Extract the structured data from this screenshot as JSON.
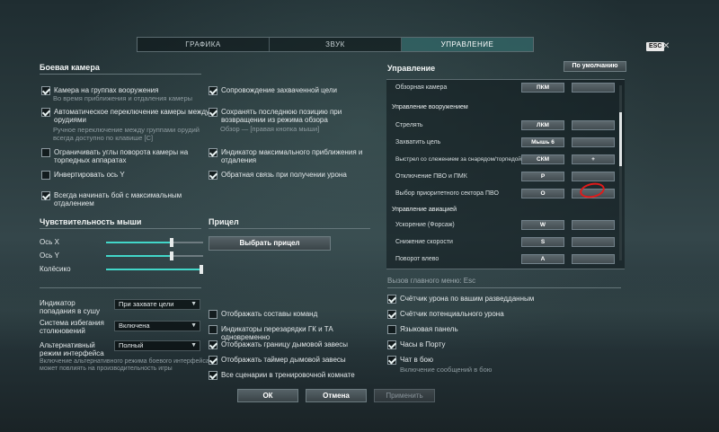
{
  "tabs": [
    "ГРАФИКА",
    "ЗВУК",
    "УПРАВЛЕНИЕ"
  ],
  "esc_label": "ESC",
  "close_glyph": "✕",
  "left": {
    "camera_title": "Боевая камера",
    "checks": [
      {
        "label": "Камера на группах вооружения",
        "hint": "Во время приближения и отдаления камеры",
        "on": true
      },
      {
        "label": "Автоматическое переключение камеры между орудиями",
        "hint": "Ручное переключение между группами орудий всегда доступно по клавише [C]",
        "on": true
      },
      {
        "label": "Ограничивать углы поворота камеры на торпедных аппаратах",
        "on": false
      },
      {
        "label": "Инвертировать ось Y",
        "on": false
      },
      {
        "label": "Всегда начинать бой с максимальным отдалением",
        "on": true
      }
    ],
    "mouse_title": "Чувствительность мыши",
    "sliders": [
      {
        "label": "Ось X",
        "value": 0.66
      },
      {
        "label": "Ось Y",
        "value": 0.66
      },
      {
        "label": "Колёсико",
        "value": 1.0
      }
    ],
    "fields": [
      {
        "label": "Индикатор попадания в сушу",
        "value": "При захвате цели"
      },
      {
        "label": "Система избегания столкновений",
        "value": "Включена"
      },
      {
        "label": "Альтернативный режим интерфейса",
        "value": "Полный"
      }
    ],
    "interface_hint": "Включение альтернативного режима боевого интерфейса может повлиять на производительность игры"
  },
  "middle": {
    "checks": [
      {
        "label": "Сопровождение захваченной цели",
        "on": true
      },
      {
        "label": "Сохранять последнюю позицию при возвращении из режима обзора",
        "hint": "Обзор — [правая кнопка мыши]",
        "on": true
      },
      {
        "label": "Индикатор максимального приближения и отдаления",
        "on": true
      },
      {
        "label": "Обратная связь при получении урона",
        "on": true
      }
    ],
    "sight_title": "Прицел",
    "sight_button": "Выбрать прицел",
    "lower_checks": [
      {
        "label": "Отображать составы команд",
        "on": false
      },
      {
        "label": "Индикаторы перезарядки ГК и ТА одновременно",
        "on": false
      },
      {
        "label": "Отображать границу дымовой завесы",
        "on": true
      },
      {
        "label": "Отображать таймер дымовой завесы",
        "on": true
      },
      {
        "label": "Все сценарии в тренировочной комнате",
        "on": true
      }
    ]
  },
  "right": {
    "controls_title": "Управление",
    "default_button": "По умолчанию",
    "rows": [
      {
        "type": "row",
        "label": "Обзорная камера",
        "key1": "ПКМ",
        "key2": ""
      },
      {
        "type": "head",
        "label": "Управление вооружением"
      },
      {
        "type": "row",
        "label": "Стрелять",
        "key1": "ЛКМ",
        "key2": ""
      },
      {
        "type": "row",
        "label": "Захватить цель",
        "key1": "Мышь 6",
        "key2": ""
      },
      {
        "type": "row",
        "label": "Выстрел со слежением за снарядом/торпедой",
        "key1": "СКМ",
        "key2": "+"
      },
      {
        "type": "row",
        "label": "Отключение ПВО и ПМК",
        "key1": "P",
        "key2": ""
      },
      {
        "type": "row",
        "label": "Выбор приоритетного сектора ПВО",
        "key1": "O",
        "key2": ""
      },
      {
        "type": "head",
        "label": "Управление авиацией"
      },
      {
        "type": "row",
        "label": "Ускорение (Форсаж)",
        "key1": "W",
        "key2": ""
      },
      {
        "type": "row",
        "label": "Снижение скорости",
        "key1": "S",
        "key2": ""
      },
      {
        "type": "row",
        "label": "Поворот влево",
        "key1": "A",
        "key2": ""
      }
    ],
    "menu_call": "Вызов главного меню: Esc",
    "checks": [
      {
        "label": "Счётчик урона по вашим разведданным",
        "on": true
      },
      {
        "label": "Счётчик потенциального урона",
        "on": true
      },
      {
        "label": "Языковая панель",
        "on": false
      },
      {
        "label": "Часы в Порту",
        "on": true
      },
      {
        "label": "Чат в бою",
        "hint": "Включение сообщений в бою",
        "on": true
      }
    ]
  },
  "footer": {
    "ok": "ОК",
    "cancel": "Отмена",
    "apply": "Применить"
  }
}
